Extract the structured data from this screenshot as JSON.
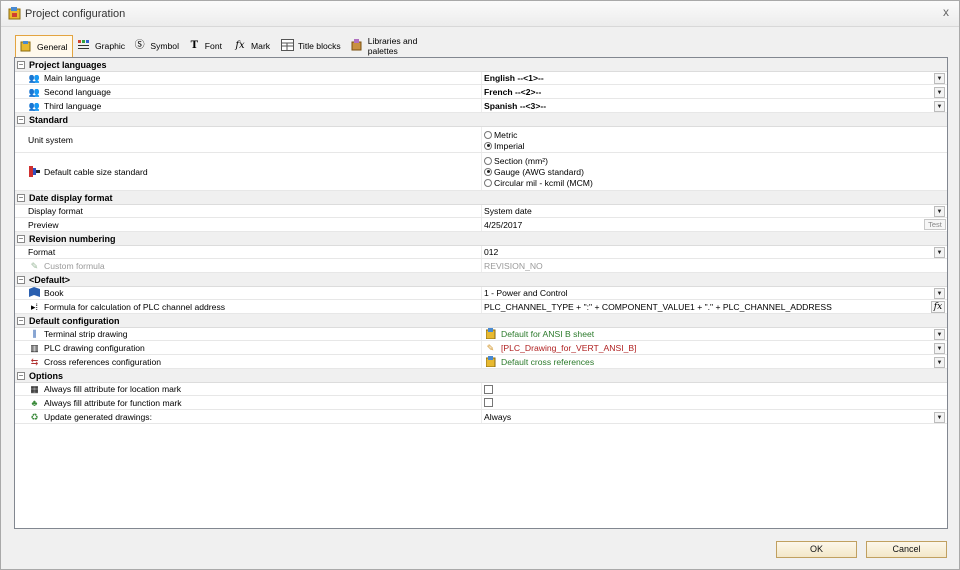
{
  "window": {
    "title": "Project configuration",
    "close_glyph": "x"
  },
  "tabs": [
    {
      "label": "General",
      "icon": "general-icon"
    },
    {
      "label": "Graphic",
      "icon": "graphic-icon"
    },
    {
      "label": "Symbol",
      "icon": "symbol-icon"
    },
    {
      "label": "Font",
      "icon": "font-icon"
    },
    {
      "label": "Mark",
      "icon": "mark-icon"
    },
    {
      "label": "Title blocks",
      "icon": "title-blocks-icon"
    },
    {
      "label": "Libraries and palettes",
      "icon": "libraries-icon"
    }
  ],
  "sections": {
    "languages": {
      "title": "Project languages",
      "main_label": "Main language",
      "main_value": "English --<1>--",
      "second_label": "Second language",
      "second_value": "French --<2>--",
      "third_label": "Third language",
      "third_value": "Spanish --<3>--"
    },
    "standard": {
      "title": "Standard",
      "unit_label": "Unit system",
      "unit_options": [
        "Metric",
        "Imperial"
      ],
      "unit_selected": "Imperial",
      "cable_label": "Default cable size standard",
      "cable_options": [
        "Section (mm²)",
        "Gauge (AWG standard)",
        "Circular mil - kcmil (MCM)"
      ],
      "cable_selected": "Gauge (AWG standard)"
    },
    "date": {
      "title": "Date display format",
      "format_label": "Display format",
      "format_value": "System date",
      "preview_label": "Preview",
      "preview_value": "4/25/2017",
      "test_label": "Test"
    },
    "revision": {
      "title": "Revision numbering",
      "format_label": "Format",
      "format_value": "012",
      "formula_label": "Custom formula",
      "formula_value": "REVISION_NO"
    },
    "defaults": {
      "title": "<Default>",
      "book_label": "Book",
      "book_value": "1 - Power and Control",
      "plc_label": "Formula for calculation of PLC channel address",
      "plc_value": "PLC_CHANNEL_TYPE + \":\" + COMPONENT_VALUE1 + \".\" + PLC_CHANNEL_ADDRESS"
    },
    "config": {
      "title": "Default configuration",
      "terminal_label": "Terminal strip drawing",
      "terminal_value": "Default for ANSI B sheet",
      "plc_label": "PLC drawing configuration",
      "plc_value": "[PLC_Drawing_for_VERT_ANSI_B]",
      "xref_label": "Cross references configuration",
      "xref_value": "Default cross references"
    },
    "options": {
      "title": "Options",
      "location_label": "Always fill attribute for location mark",
      "function_label": "Always fill attribute for function mark",
      "update_label": "Update generated drawings:",
      "update_value": "Always"
    }
  },
  "buttons": {
    "ok": "OK",
    "cancel": "Cancel"
  },
  "colors": {
    "accent": "#e3a440",
    "config_green": "#2b7a2b",
    "config_red": "#b02020"
  }
}
